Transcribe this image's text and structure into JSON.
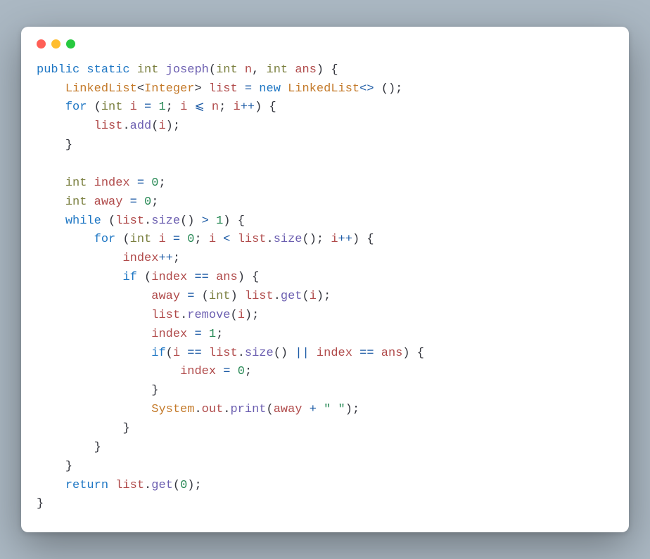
{
  "language": "java",
  "window": {
    "buttons": [
      "close",
      "minimize",
      "zoom"
    ]
  },
  "code": {
    "tokens": {
      "kw_public": "public",
      "kw_static": "static",
      "kw_new": "new",
      "kw_for": "for",
      "kw_while": "while",
      "kw_if": "if",
      "kw_return": "return",
      "ty_int": "int",
      "cls_LinkedList": "LinkedList",
      "cls_Integer": "Integer",
      "cls_System": "System",
      "fn_joseph": "joseph",
      "fn_add": "add",
      "fn_size": "size",
      "fn_get": "get",
      "fn_remove": "remove",
      "fn_print": "print",
      "fld_out": "out",
      "v_n": "n",
      "v_ans": "ans",
      "v_list": "list",
      "v_i": "i",
      "v_index": "index",
      "v_away": "away",
      "n0": "0",
      "n1": "1",
      "op_assign": "=",
      "op_plus": "+",
      "op_le": "⩽",
      "op_gt": ">",
      "op_lt": "<",
      "op_inc": "++",
      "op_eq": "==",
      "op_or": "||",
      "op_diamond": "<>",
      "str_space": "\" \""
    },
    "indent": "    "
  }
}
